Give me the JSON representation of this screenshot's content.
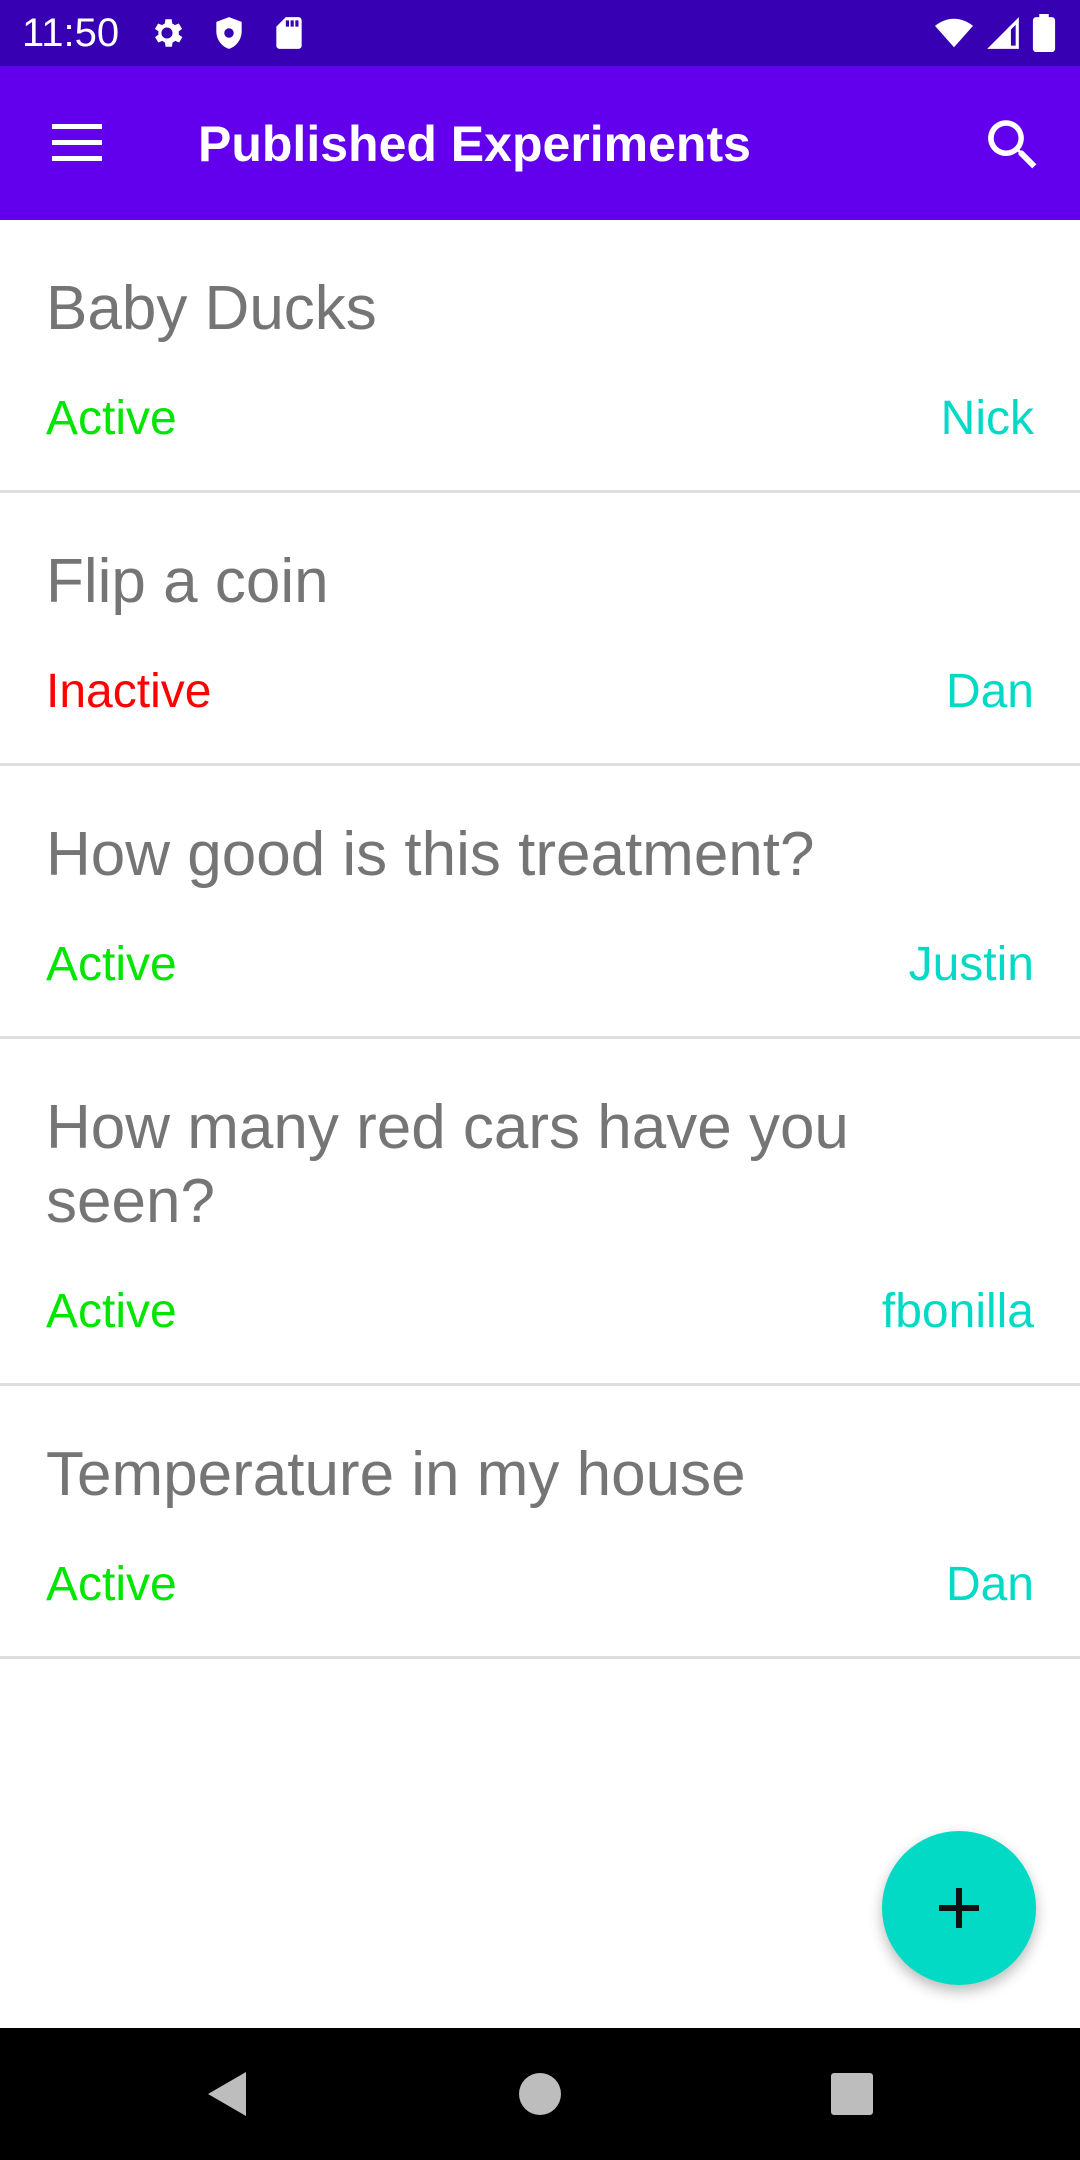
{
  "status_bar": {
    "time": "11:50",
    "left_icons": [
      "settings-icon",
      "shield-icon",
      "sd-card-icon"
    ],
    "right_icons": [
      "wifi-icon",
      "cell-signal-icon",
      "battery-icon"
    ],
    "background": "#3700b3"
  },
  "app_bar": {
    "title": "Published Experiments",
    "menu_icon": "hamburger-menu-icon",
    "search_icon": "search-icon",
    "background": "#6200ee"
  },
  "experiments": [
    {
      "title": "Baby Ducks",
      "status": "Active",
      "owner": "Nick"
    },
    {
      "title": "Flip a coin",
      "status": "Inactive",
      "owner": "Dan"
    },
    {
      "title": "How good is this treatment?",
      "status": "Active",
      "owner": "Justin"
    },
    {
      "title": "How many red cars have you seen?",
      "status": "Active",
      "owner": "fbonilla"
    },
    {
      "title": "Temperature in my house",
      "status": "Active",
      "owner": "Dan"
    }
  ],
  "colors": {
    "active": "#00e600",
    "inactive": "#ff0000",
    "owner": "#03dac5",
    "title_text": "#757575",
    "fab": "#03dac5"
  },
  "fab": {
    "icon": "plus-icon"
  },
  "nav_bar": {
    "icons": [
      "back-icon",
      "home-icon",
      "recents-icon"
    ]
  }
}
